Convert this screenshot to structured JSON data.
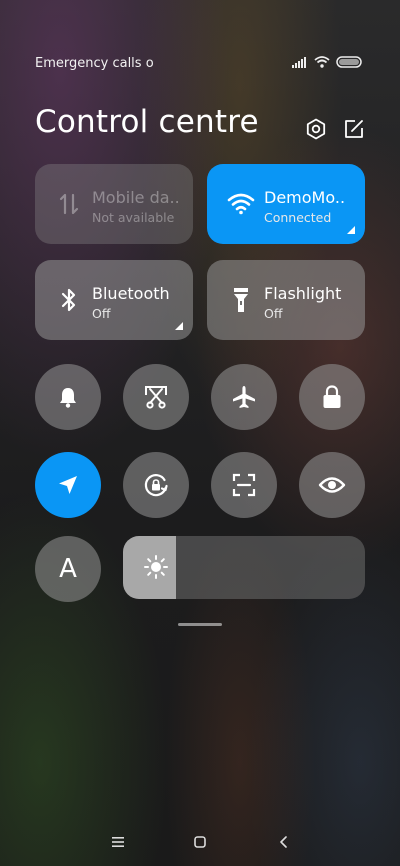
{
  "status_bar": {
    "carrier_text": "Emergency calls o"
  },
  "header": {
    "title": "Control centre"
  },
  "tiles": [
    {
      "title": "Mobile da..",
      "subtitle": "Not available",
      "state": "disabled",
      "icon": "mobile-data-icon"
    },
    {
      "title": "DemoMo..",
      "subtitle": "Connected",
      "state": "active",
      "icon": "wifi-icon"
    },
    {
      "title": "Bluetooth",
      "subtitle": "Off",
      "state": "off",
      "icon": "bluetooth-icon"
    },
    {
      "title": "Flashlight",
      "subtitle": "Off",
      "state": "off",
      "icon": "flashlight-icon"
    }
  ],
  "toggles": [
    {
      "name": "notification-bell",
      "icon": "bell-icon",
      "active": false
    },
    {
      "name": "screenshot",
      "icon": "scissors-icon",
      "active": false
    },
    {
      "name": "airplane-mode",
      "icon": "airplane-icon",
      "active": false
    },
    {
      "name": "lock-screen",
      "icon": "lock-icon",
      "active": false
    },
    {
      "name": "location",
      "icon": "location-arrow-icon",
      "active": true
    },
    {
      "name": "auto-rotate",
      "icon": "rotate-lock-icon",
      "active": false
    },
    {
      "name": "scanner",
      "icon": "scan-icon",
      "active": false
    },
    {
      "name": "reading-mode",
      "icon": "eye-icon",
      "active": false
    }
  ],
  "auto_brightness_label": "A",
  "brightness": {
    "level": 0.22,
    "icon": "sun-icon"
  },
  "colors": {
    "accent": "#0a96f5"
  }
}
